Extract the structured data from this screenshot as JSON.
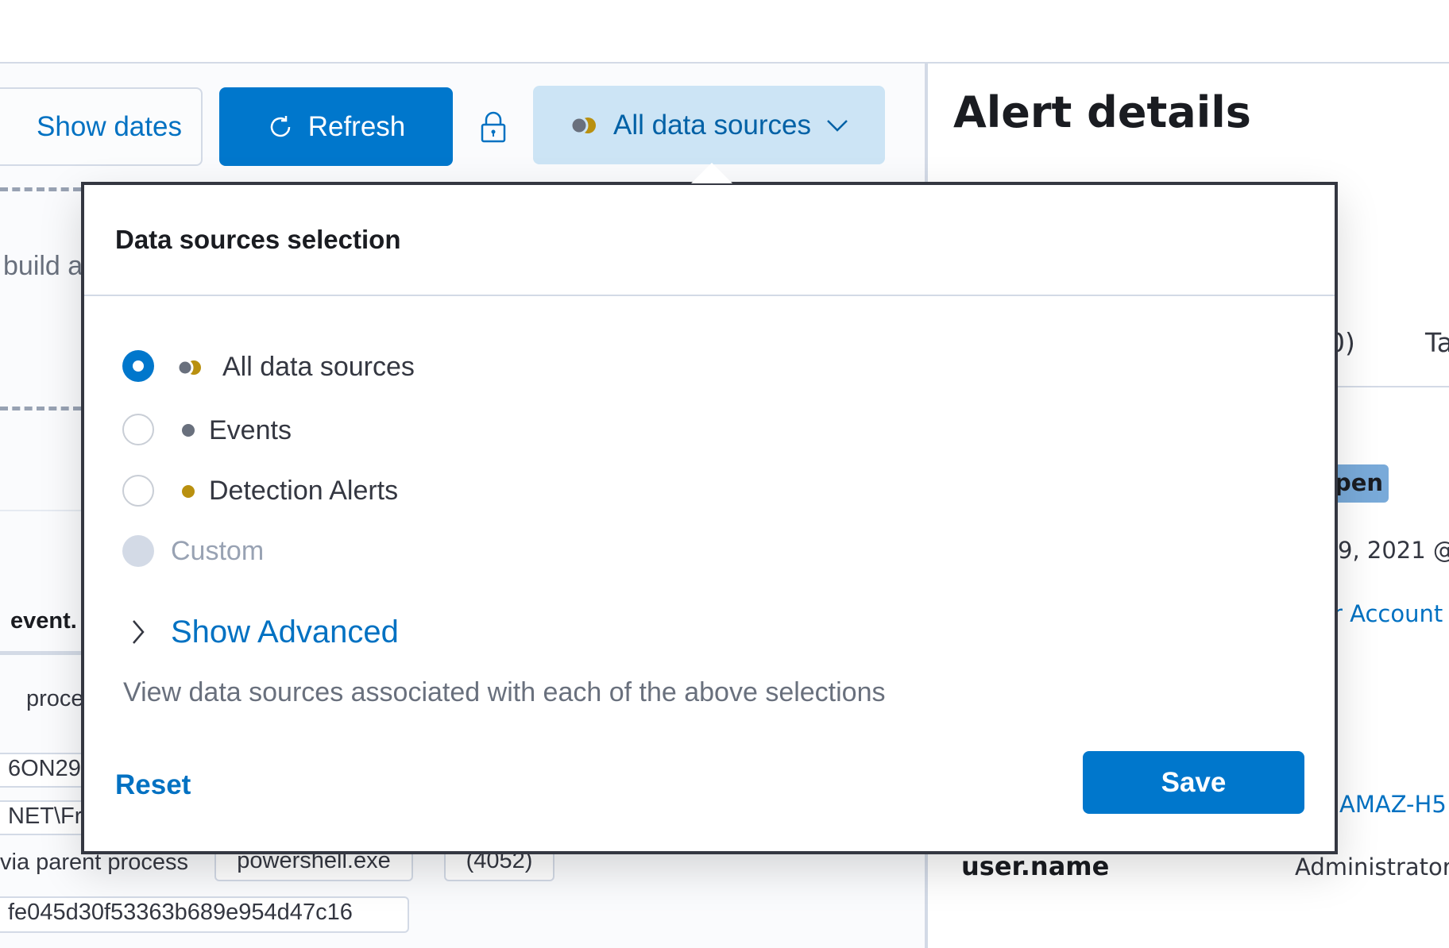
{
  "toolbar": {
    "show_dates": "Show dates",
    "refresh": "Refresh",
    "data_sources": "All data sources"
  },
  "left_bg": {
    "build_text": "build a",
    "event_header": "event.",
    "process_text": "proce",
    "field1": "6ON29",
    "field2": "NET\\Fr",
    "via_parent": "via parent process",
    "parent_name": "powershell.exe",
    "parent_pid": "(4052)",
    "hash": "fe045d30f53363b689e954d47c16"
  },
  "flyout": {
    "title": "Alert details",
    "tab_partial": "0)",
    "tab2_partial": "Ta",
    "status_badge": "pen",
    "date_partial": "9, 2021 @",
    "account_link": "r Account",
    "host_link": "AMAZ-H5",
    "user_label": "user.name",
    "user_value": "Administrator"
  },
  "popover": {
    "title": "Data sources selection",
    "options": [
      {
        "label": "All data sources",
        "selected": true,
        "disabled": false
      },
      {
        "label": "Events",
        "selected": false,
        "disabled": false
      },
      {
        "label": "Detection Alerts",
        "selected": false,
        "disabled": false
      },
      {
        "label": "Custom",
        "selected": false,
        "disabled": true
      }
    ],
    "show_advanced": "Show Advanced",
    "description": "View data sources associated with each of the above selections",
    "reset": "Reset",
    "save": "Save"
  },
  "colors": {
    "primary": "#0077cc",
    "events_dot": "#69707d",
    "alerts_dot": "#b9900f",
    "badge": "#79aad9"
  }
}
